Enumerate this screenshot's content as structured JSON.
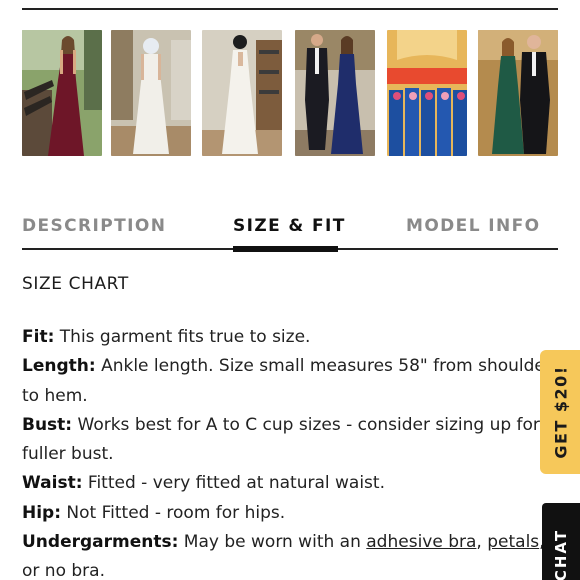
{
  "tabs": {
    "description": "DESCRIPTION",
    "size_fit": "SIZE & FIT",
    "model_info": "MODEL INFO"
  },
  "size_chart_heading": "SIZE CHART",
  "specs": {
    "fit_label": "Fit:",
    "fit_text": " This garment fits true to size.",
    "length_label": "Length:",
    "length_text": " Ankle length. Size small measures 58\" from shoulder to hem.",
    "bust_label": "Bust:",
    "bust_text": " Works best for A to C cup sizes - consider sizing up for fuller bust.",
    "waist_label": "Waist:",
    "waist_text": " Fitted - very fitted at natural waist.",
    "hip_label": "Hip:",
    "hip_text": " Not Fitted - room for hips.",
    "undergarments_label": "Undergarments:",
    "undergarments_pre": " May be worn with an ",
    "undergarments_link1": "adhesive bra",
    "undergarments_mid": ", ",
    "undergarments_link2": "petals",
    "undergarments_post": ", or no bra."
  },
  "promo": "GET $20!",
  "chat": "CHAT",
  "colors": {
    "accent_yellow": "#f6c85a",
    "burgundy": "#6e1628",
    "navy": "#1f2d6b",
    "royal": "#1d4fa0",
    "emerald": "#1f5a45"
  }
}
